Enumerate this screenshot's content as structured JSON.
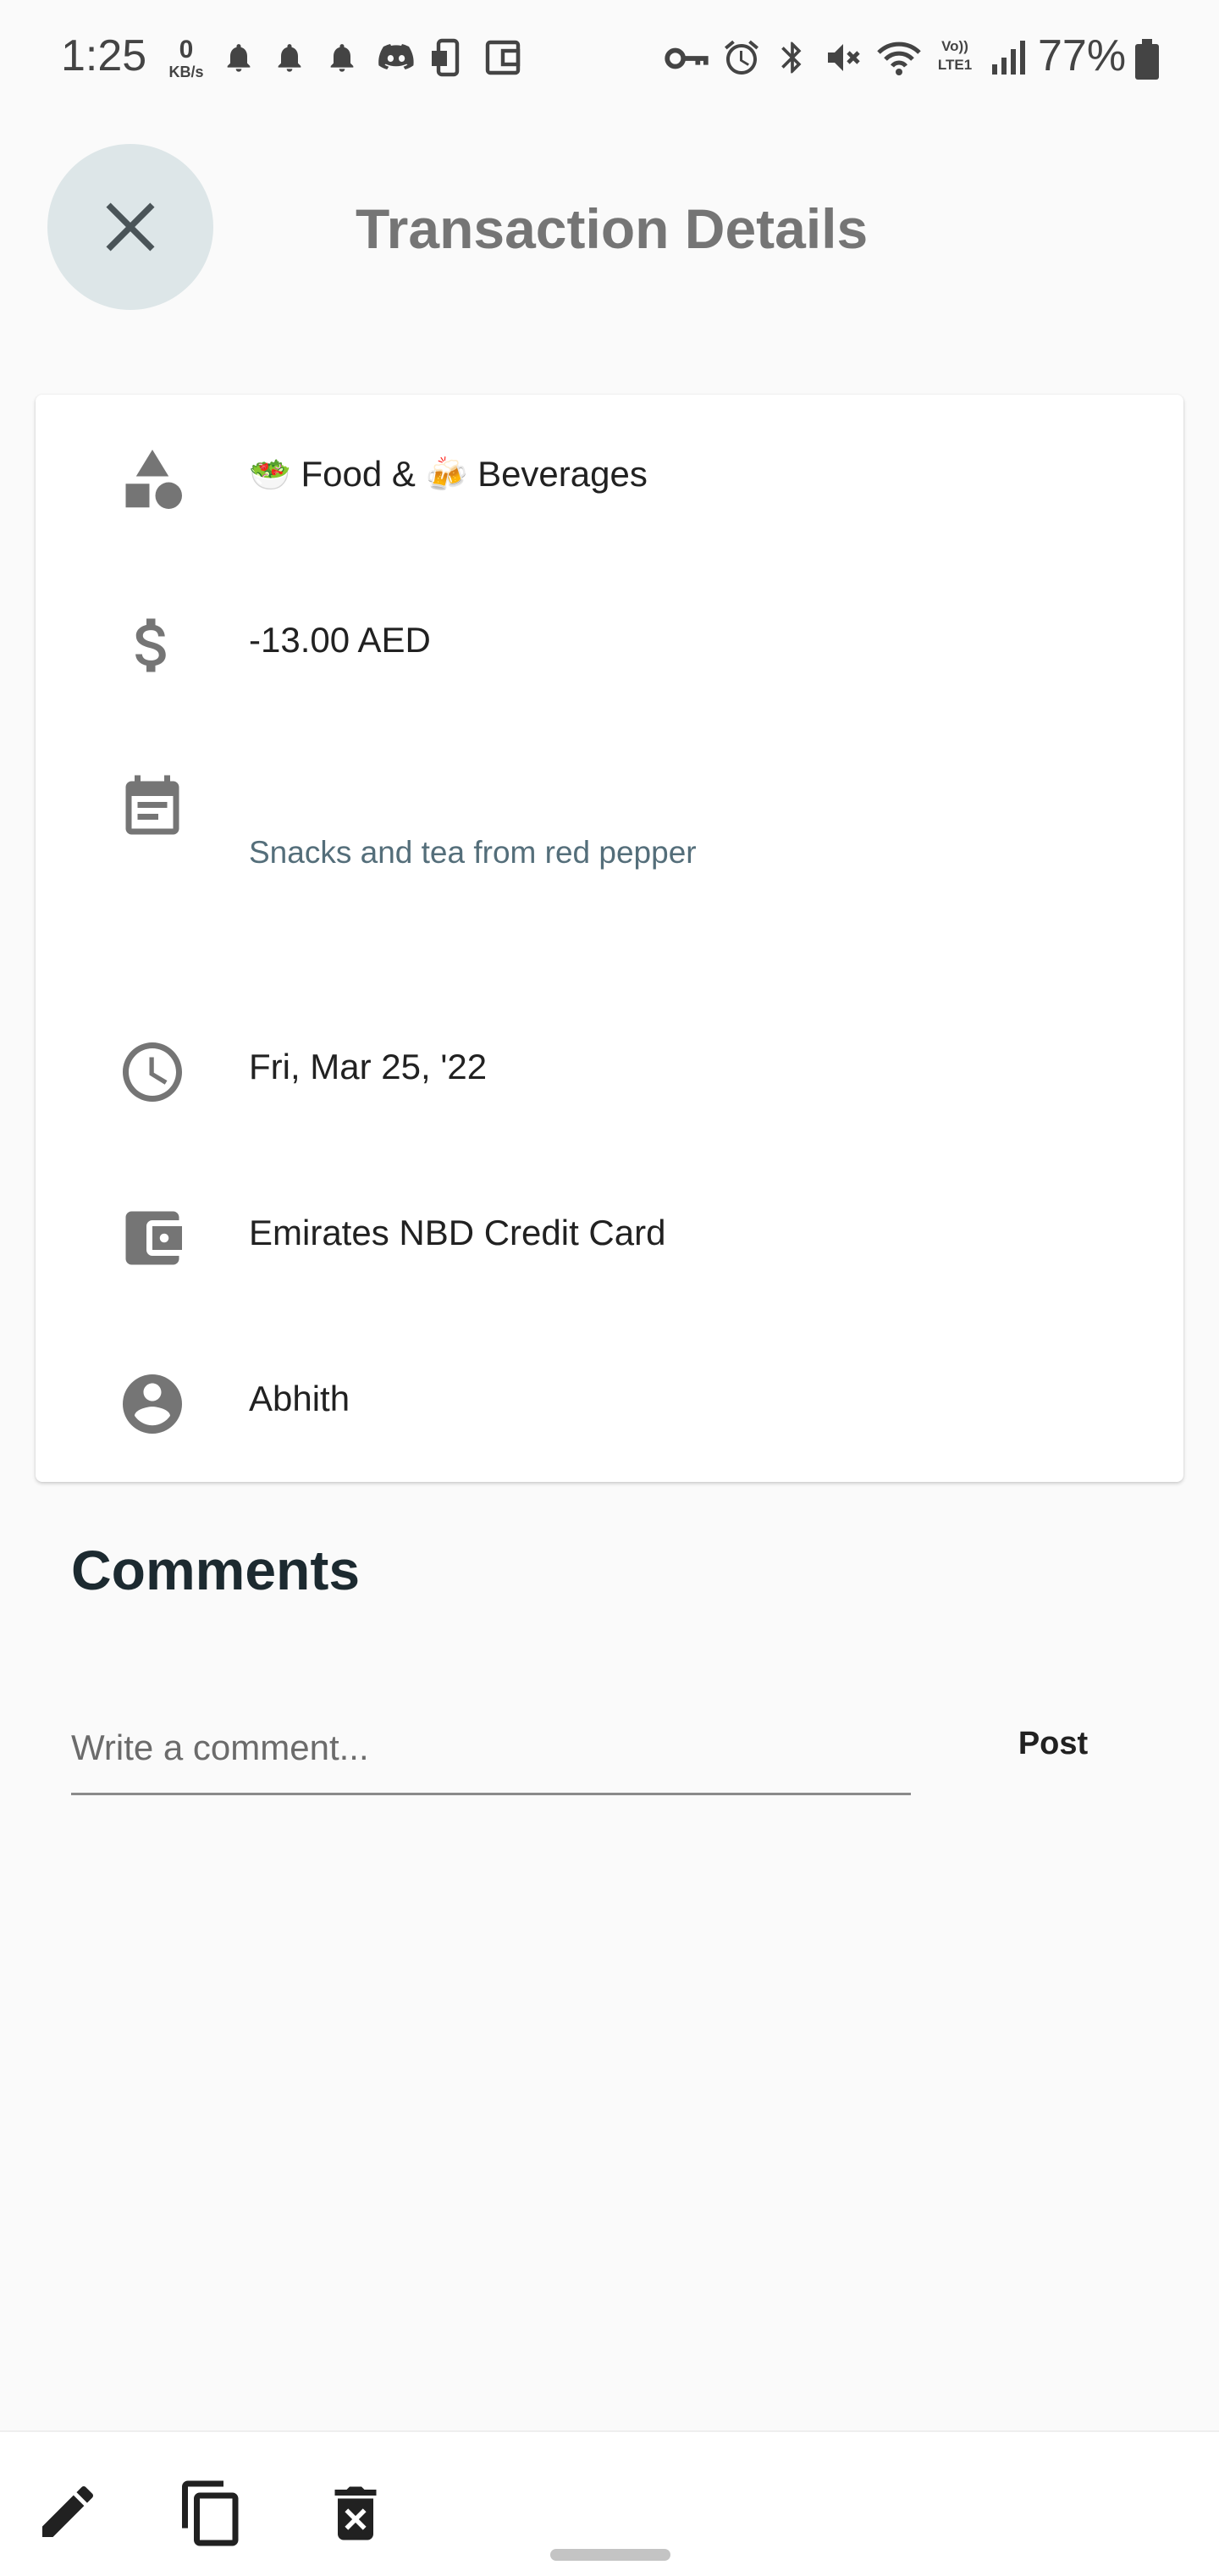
{
  "status_bar": {
    "time": "1:25",
    "network_speed_value": "0",
    "network_speed_unit": "KB/s",
    "battery": "77%",
    "lte_label_top": "Vo))",
    "lte_label_bottom": "LTE1"
  },
  "header": {
    "title": "Transaction Details",
    "close_icon": "close-icon"
  },
  "details": {
    "category": {
      "icon": "category-shapes-icon",
      "emoji1": "🥗",
      "text1": "Food &",
      "emoji2": "🍻",
      "text2": "Beverages"
    },
    "amount": {
      "icon": "dollar-icon",
      "value": "-13.00 AED"
    },
    "note": {
      "icon": "note-calendar-icon",
      "value": "Snacks and tea from red pepper"
    },
    "date": {
      "icon": "clock-icon",
      "value": "Fri, Mar 25, '22"
    },
    "account": {
      "icon": "wallet-icon",
      "value": "Emirates NBD Credit Card"
    },
    "payer": {
      "icon": "account-circle-icon",
      "value": "Abhith"
    }
  },
  "comments": {
    "title": "Comments",
    "placeholder": "Write a comment...",
    "post_label": "Post"
  },
  "bottom_actions": [
    {
      "name": "edit",
      "icon": "pencil-icon"
    },
    {
      "name": "duplicate",
      "icon": "copy-icon"
    },
    {
      "name": "delete",
      "icon": "trash-icon"
    }
  ],
  "colors": {
    "background": "#fafafa",
    "close_button_bg": "#dde6e8",
    "title": "#757575",
    "icon_gray": "#757575",
    "note_text": "#546e7a"
  }
}
